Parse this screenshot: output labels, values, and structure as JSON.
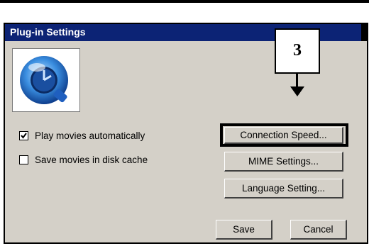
{
  "window": {
    "title": "Plug-in Settings"
  },
  "icon": {
    "name": "quicktime-logo-icon"
  },
  "options": [
    {
      "label": "Play movies automatically",
      "checked": true
    },
    {
      "label": "Save movies in disk cache",
      "checked": false
    }
  ],
  "buttons": {
    "connection_speed": "Connection Speed...",
    "mime_settings": "MIME Settings...",
    "language_setting": "Language Setting...",
    "save": "Save",
    "cancel": "Cancel"
  },
  "callout": {
    "number": "3"
  },
  "colors": {
    "titlebar": "#0c2375",
    "dialog_bg": "#d4d0c8"
  }
}
